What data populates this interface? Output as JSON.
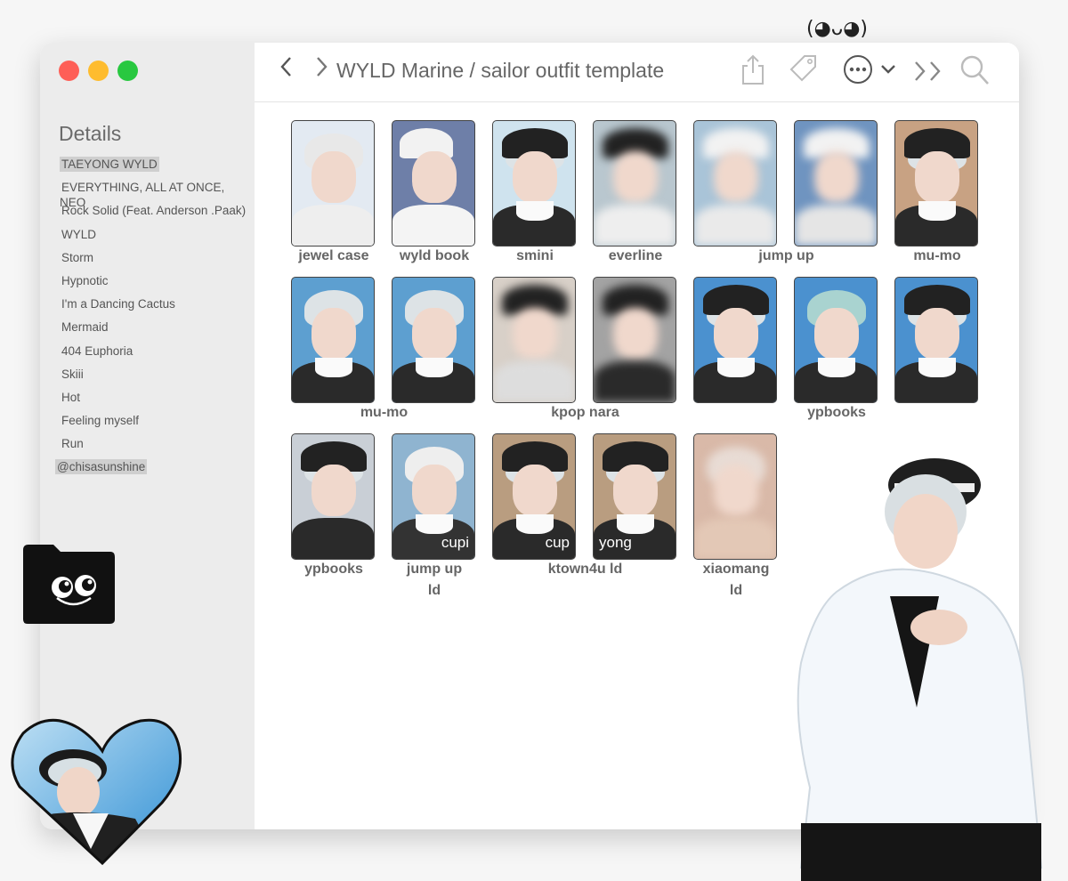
{
  "decoration": {
    "kaomoji": "(◕ᴗ◕)"
  },
  "sidebar": {
    "title": "Details",
    "items": [
      {
        "label": "TAEYONG WYLD",
        "highlight": true
      },
      {
        "label": "EVERYTHING, ALL AT ONCE, NEO"
      },
      {
        "label": "Rock Solid (Feat. Anderson .Paak)"
      },
      {
        "label": "WYLD"
      },
      {
        "label": "Storm"
      },
      {
        "label": "Hypnotic"
      },
      {
        "label": "I'm a Dancing Cactus"
      },
      {
        "label": "Mermaid"
      },
      {
        "label": "404 Euphoria"
      },
      {
        "label": "Skiii"
      },
      {
        "label": "Hot"
      },
      {
        "label": "Feeling myself"
      },
      {
        "label": "Run"
      },
      {
        "label": "@chisasunshine",
        "highlight": true
      }
    ]
  },
  "toolbar": {
    "back_icon": "chevron-left",
    "forward_icon": "chevron-right",
    "path": "WYLD Marine / sailor outfit template",
    "icons": [
      "share-icon",
      "tag-icon",
      "more-icon",
      "chevron-down-icon",
      "double-chevron-icon",
      "search-icon"
    ]
  },
  "grid": {
    "labels": [
      "jewel case",
      "wyld book",
      "smini",
      "everline",
      "jump up",
      "mu-mo",
      "mu-mo",
      "kpop nara",
      "ypbooks",
      "ypbooks",
      "jump up\nld",
      "ktown4u ld",
      "xiaomang\nld"
    ],
    "overlays": [
      "cupi",
      "cup",
      "yong"
    ]
  },
  "colors": {
    "close": "#fe5f57",
    "minimize": "#febc2e",
    "maximize": "#28c840",
    "sidebar_bg": "#ececec",
    "highlight": "#cfcfcf"
  }
}
